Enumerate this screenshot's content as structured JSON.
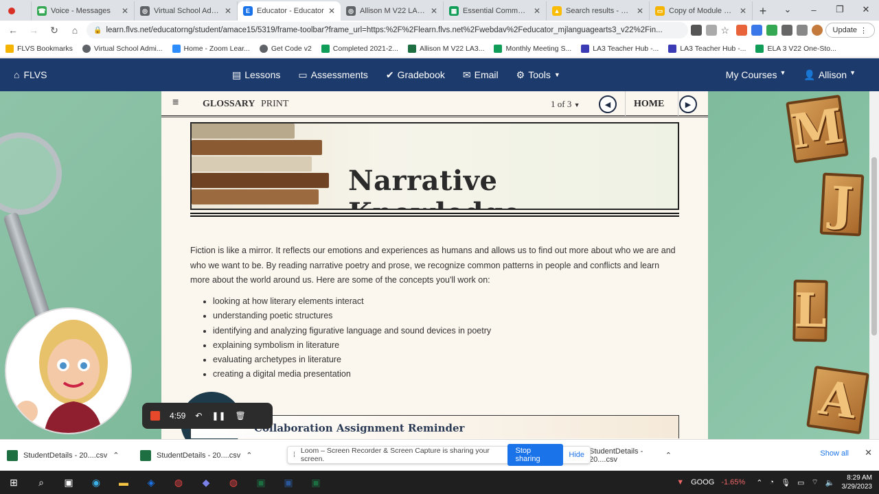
{
  "browser": {
    "tabs": [
      {
        "label": "Voice - Messages",
        "color": "#34a853",
        "icon": "phone-icon"
      },
      {
        "label": "Virtual School Admi...",
        "color": "#5f6368",
        "icon": "globe-icon"
      },
      {
        "label": "Educator - Educator",
        "color": "#1a73e8",
        "icon": "educator-icon",
        "active": true
      },
      {
        "label": "Allison M V22 LA3...",
        "color": "#5f6368",
        "icon": "globe-icon"
      },
      {
        "label": "Essential Communi...",
        "color": "#0f9d58",
        "icon": "sheets-icon"
      },
      {
        "label": "Search results - Goo",
        "color": "#fbbc04",
        "icon": "drive-icon"
      },
      {
        "label": "Copy of Module 5 M",
        "color": "#f4b400",
        "icon": "slides-icon"
      }
    ],
    "url": "learn.flvs.net/educatorng/student/amace15/5319/frame-toolbar?frame_url=https:%2F%2Flearn.flvs.net%2Fwebdav%2Feducator_mjlanguagearts3_v22%2Fin...",
    "update_label": "Update",
    "bookmarks": [
      {
        "label": "FLVS Bookmarks",
        "color": "#f4b400"
      },
      {
        "label": "Virtual School Admi...",
        "color": "#5f6368"
      },
      {
        "label": "Home - Zoom Lear...",
        "color": "#2d8cff"
      },
      {
        "label": "Get Code v2",
        "color": "#5f6368"
      },
      {
        "label": "Completed 2021-2...",
        "color": "#0f9d58"
      },
      {
        "label": "Allison M V22 LA3...",
        "color": "#1d6f42"
      },
      {
        "label": "Monthly Meeting S...",
        "color": "#0f9d58"
      },
      {
        "label": "LA3 Teacher Hub -...",
        "color": "#3b3bb5"
      },
      {
        "label": "LA3 Teacher Hub -...",
        "color": "#3b3bb5"
      },
      {
        "label": "ELA 3 V22 One-Sto...",
        "color": "#0f9d58"
      }
    ]
  },
  "nav": {
    "brand": "FLVS",
    "items": [
      "Lessons",
      "Assessments",
      "Gradebook",
      "Email",
      "Tools"
    ],
    "my_courses": "My Courses",
    "user": "Allison"
  },
  "lesson": {
    "glossary": "GLOSSARY",
    "print": "PRINT",
    "pager": "1 of 3",
    "home": "HOME",
    "banner_title": "Narrative Knowledge",
    "intro": "Fiction is like a mirror. It reflects our emotions and experiences as humans and allows us to find out more about who we are and who we want to be. By reading narrative poetry and prose, we recognize common patterns in people and conflicts and learn more about the world around us. Here are some of the concepts you'll work on:",
    "concepts": [
      "looking at how literary elements interact",
      "understanding poetic structures",
      "identifying and analyzing figurative language and sound devices in poetry",
      "explaining symbolism in literature",
      "evaluating archetypes in literature",
      "creating a digital media presentation"
    ],
    "collab_title": "Collaboration Assignment Reminder"
  },
  "decor_letters": [
    "M",
    "J",
    "L",
    "A"
  ],
  "recorder": {
    "time": "4:59"
  },
  "downloads": {
    "items": [
      "StudentDetails - 20....csv",
      "StudentDetails - 20....csv",
      "StudentDetails - 20....csv"
    ],
    "sharing_text": "Loom – Screen Recorder & Screen Capture is sharing your screen.",
    "stop_label": "Stop sharing",
    "hide_label": "Hide",
    "show_all": "Show all"
  },
  "taskbar": {
    "stock_symbol": "GOOG",
    "stock_change": "-1.65%",
    "time": "8:29 AM",
    "date": "3/29/2023"
  }
}
